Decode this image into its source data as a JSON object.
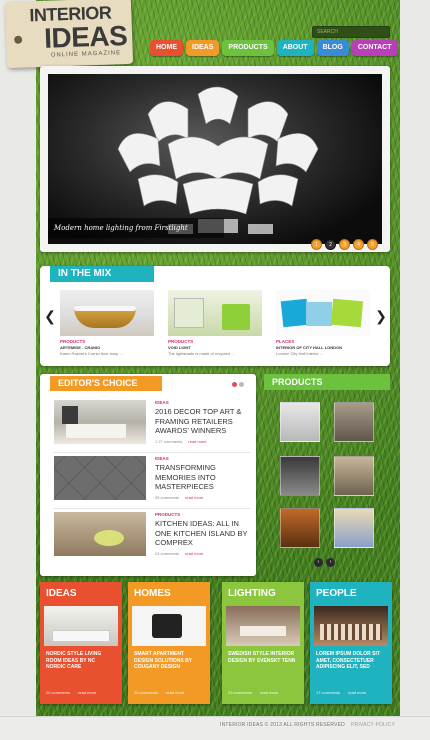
{
  "logo": {
    "line1": "INTERIOR",
    "line2": "IDEAS",
    "tagline": "ONLINE MAGAZINE"
  },
  "search": {
    "placeholder": "SEARCH"
  },
  "nav": [
    {
      "label": "Home",
      "color": "#e8502f"
    },
    {
      "label": "Ideas",
      "color": "#f39a26"
    },
    {
      "label": "Products",
      "color": "#6cc13e"
    },
    {
      "label": "About",
      "color": "#1fb3c0"
    },
    {
      "label": "Blog",
      "color": "#3a8bd6"
    },
    {
      "label": "Contact",
      "color": "#b83fb8"
    }
  ],
  "hero": {
    "caption": "Modern home lighting from Firstlight",
    "pages": [
      "1",
      "2",
      "3",
      "4",
      "5"
    ],
    "active_page": 2
  },
  "mix": {
    "title": "IN THE MIX",
    "items": [
      {
        "category": "PRODUCTS",
        "subtitle": "ARTEMIDE - CRANIO",
        "desc": "Karim Rashid's Cranio floor lamp ..."
      },
      {
        "category": "PRODUCTS",
        "subtitle": "VOID LIGHT",
        "desc": "The lightshade is made of recycled ..."
      },
      {
        "category": "PLACES",
        "subtitle": "INTERIOR OF CITY HALL LONDON",
        "desc": "London City Hall interior ..."
      }
    ]
  },
  "editors": {
    "title": "EDITOR'S CHOICE",
    "items": [
      {
        "category": "IDEAS",
        "title": "2016 DECOR TOP ART & FRAMING RETAILERS AWARDS' WINNERS",
        "comments": "1 27 comments",
        "more": "read more"
      },
      {
        "category": "IDEAS",
        "title": "TRANSFORMING MEMORIES INTO MASTERPIECES",
        "comments": "35 comments",
        "more": "read more"
      },
      {
        "category": "PRODUCTS",
        "title": "KITCHEN IDEAS: ALL IN ONE KITCHEN ISLAND BY COMPREX",
        "comments": "24 comments",
        "more": "read more"
      }
    ]
  },
  "products": {
    "title": "PRODUCTS",
    "nav": [
      "1",
      "2",
      "3"
    ]
  },
  "cards": [
    {
      "title": "IDEAS",
      "color": "#e8502f",
      "text": "NORDIC STYLE LIVING ROOM IDEAS BY NC NORDIC CARE",
      "comments": "20 comments",
      "more": "read more"
    },
    {
      "title": "HOMES",
      "color": "#f39a26",
      "text": "SMART APARTMENT DESIGN SOLUTIONS BY COUGANY DESIGN",
      "comments": "20 comments",
      "more": "read more"
    },
    {
      "title": "LIGHTING",
      "color": "#8cc63e",
      "text": "SWEDISH STYLE INTERIOR DESIGN BY SVENSKT TENN",
      "comments": "23 comments",
      "more": "read more"
    },
    {
      "title": "PEOPLE",
      "color": "#1fb3c0",
      "text": "LOREM IPSUM DOLOR SIT AMET, CONSECTETUER ADIPISCING ELIT, SED",
      "comments": "17 comments",
      "more": "read more"
    }
  ],
  "footer": {
    "copyright": "INTERIOR IDEAS © 2013 ALL RIGHTS RESERVED",
    "privacy": "PRIVACY POLICY"
  }
}
